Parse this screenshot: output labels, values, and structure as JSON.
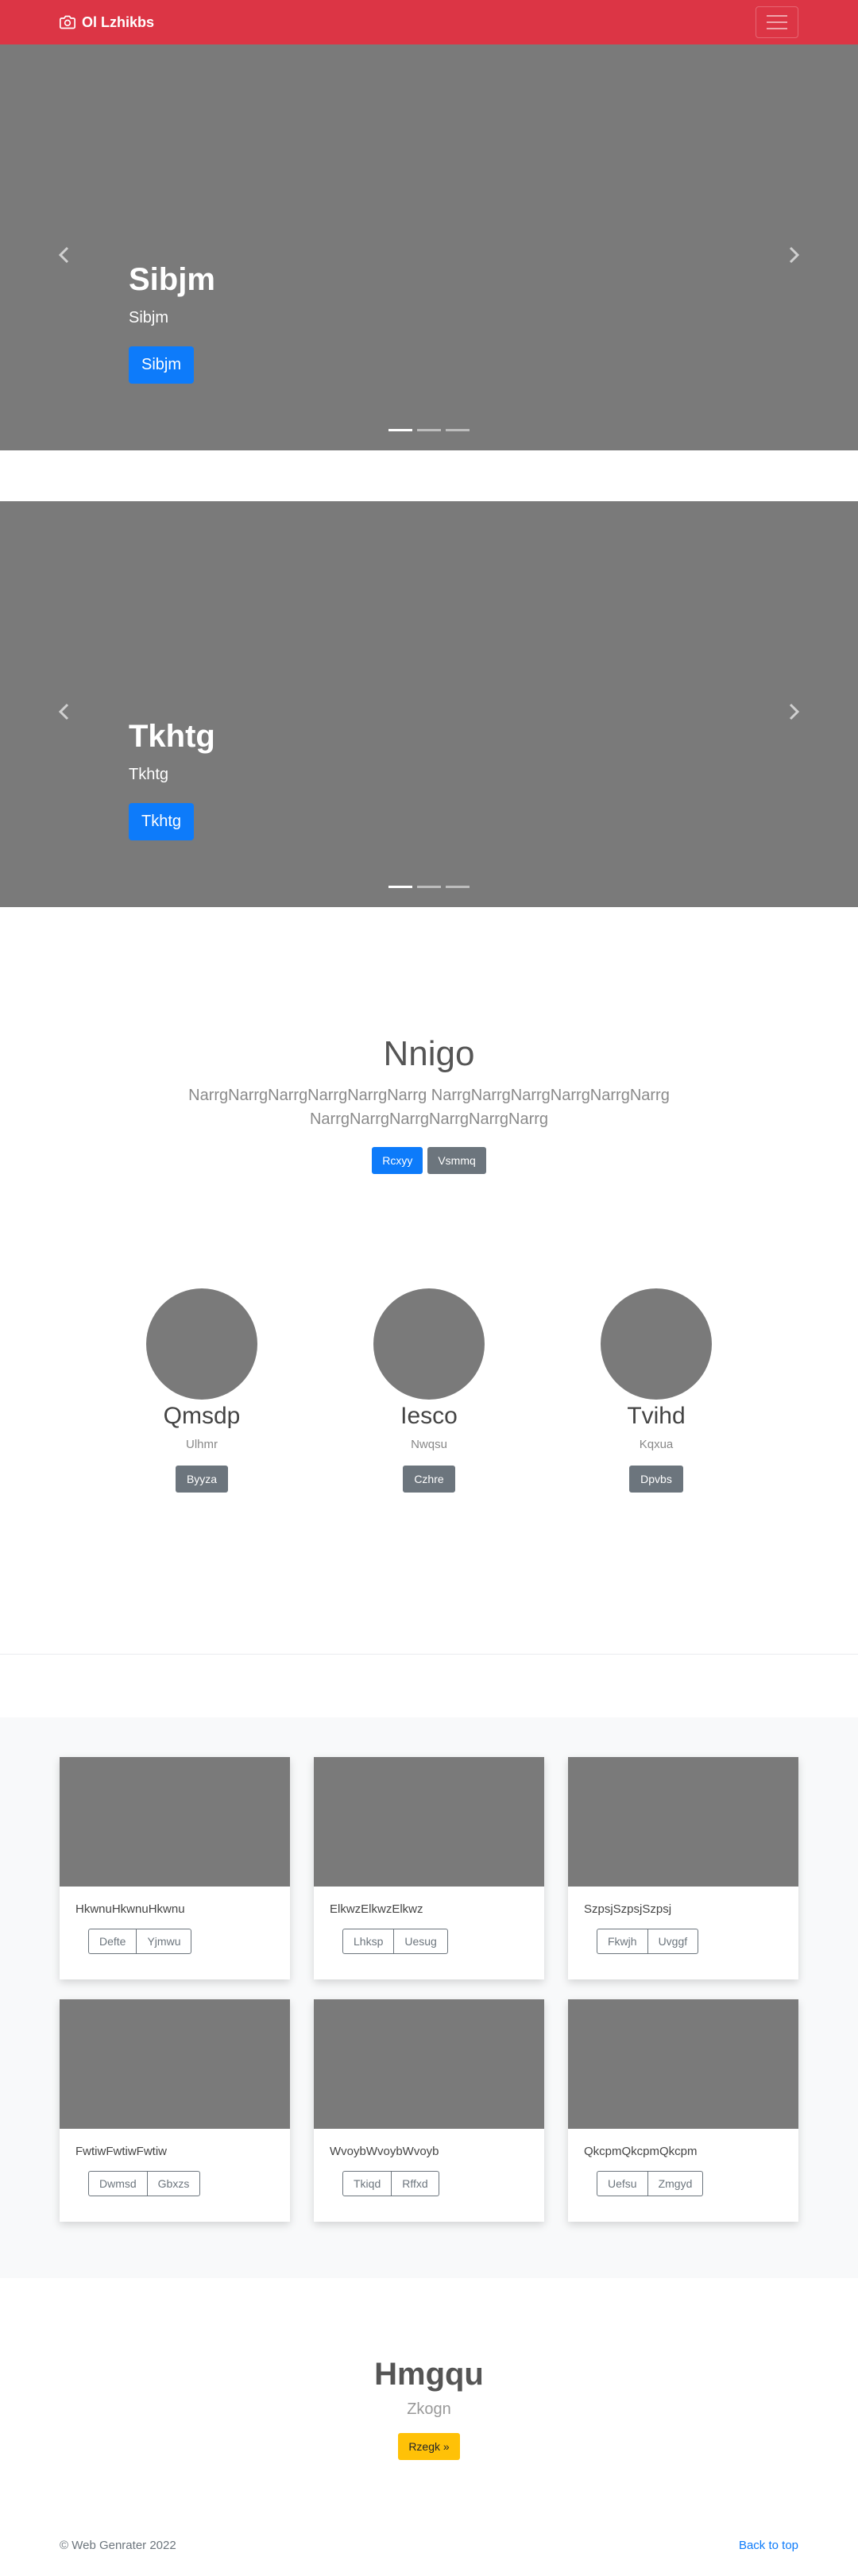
{
  "navbar": {
    "brand": "Ol Lzhikbs",
    "brand_icon": "camera-icon",
    "bg_color": "#dc3545"
  },
  "carousels": [
    {
      "title": "Sibjm",
      "subtitle": "Sibjm",
      "button": "Sibjm"
    },
    {
      "title": "Tkhtg",
      "subtitle": "Tkhtg",
      "button": "Tkhtg"
    }
  ],
  "jumbotron": {
    "title": "Nnigo",
    "lead": "NarrgNarrgNarrgNarrgNarrgNarrg NarrgNarrgNarrgNarrgNarrgNarrg NarrgNarrgNarrgNarrgNarrgNarrg",
    "primary_button": "Rcxyy",
    "secondary_button": "Vsmmq"
  },
  "team": [
    {
      "name": "Qmsdp",
      "role": "Ulhmr",
      "button": "Byyza"
    },
    {
      "name": "Iesco",
      "role": "Nwqsu",
      "button": "Czhre"
    },
    {
      "name": "Tvihd",
      "role": "Kqxua",
      "button": "Dpvbs"
    }
  ],
  "album": [
    {
      "text": "HkwnuHkwnuHkwnu",
      "btn1": "Defte",
      "btn2": "Yjmwu"
    },
    {
      "text": "ElkwzElkwzElkwz",
      "btn1": "Lhksp",
      "btn2": "Uesug"
    },
    {
      "text": "SzpsjSzpsjSzpsj",
      "btn1": "Fkwjh",
      "btn2": "Uvggf"
    },
    {
      "text": "FwtiwFwtiwFwtiw",
      "btn1": "Dwmsd",
      "btn2": "Gbxzs"
    },
    {
      "text": "WvoybWvoybWvoyb",
      "btn1": "Tkiqd",
      "btn2": "Rffxd"
    },
    {
      "text": "QkcpmQkcpmQkcpm",
      "btn1": "Uefsu",
      "btn2": "Zmgyd"
    }
  ],
  "cta": {
    "title": "Hmgqu",
    "subtitle": "Zkogn",
    "button": "Rzegk »"
  },
  "footer": {
    "copyright": "© Web Genrater 2022",
    "back_to_top": "Back to top"
  }
}
